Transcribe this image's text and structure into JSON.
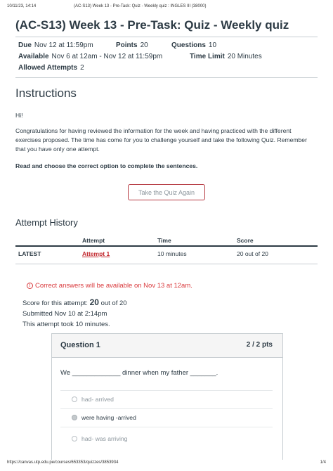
{
  "print_header": {
    "datetime": "10/11/23, 14:14",
    "doc_title": "(AC-S13) Week 13 - Pre-Task: Quiz - Weekly quiz : INGLES III (38000)"
  },
  "quiz": {
    "title": "(AC-S13) Week 13 - Pre-Task: Quiz - Weekly quiz",
    "due_label": "Due",
    "due_value": "Nov 12 at 11:59pm",
    "points_label": "Points",
    "points_value": "20",
    "questions_label": "Questions",
    "questions_value": "10",
    "available_label": "Available",
    "available_value": "Nov 6 at 12am - Nov 12 at 11:59pm",
    "time_limit_label": "Time Limit",
    "time_limit_value": "20 Minutes",
    "allowed_attempts_label": "Allowed Attempts",
    "allowed_attempts_value": "2"
  },
  "instructions": {
    "heading": "Instructions",
    "greeting": "Hi!",
    "body": "Congratulations for having reviewed the information for the week and having practiced with the different exercises proposed. The time has come for you to challenge yourself and take the following Quiz. Remember that you have only one attempt.",
    "directive": "Read and choose the correct option to complete the sentences.",
    "button_label": "Take the Quiz Again"
  },
  "attempt_history": {
    "heading": "Attempt History",
    "columns": [
      "Attempt",
      "Time",
      "Score"
    ],
    "rows": [
      {
        "tag": "LATEST",
        "attempt": "Attempt 1",
        "time": "10 minutes",
        "score": "20 out of 20"
      }
    ]
  },
  "result": {
    "notice": "Correct answers will be available on Nov 13 at 12am.",
    "score_prefix": "Score for this attempt:",
    "score_value": "20",
    "score_suffix": "out of 20",
    "submitted": "Submitted Nov 10 at 2:14pm",
    "duration": "This attempt took 10 minutes."
  },
  "question": {
    "title": "Question 1",
    "points": "2 / 2 pts",
    "text": "We _____________ dinner when my father _______.",
    "answers": [
      {
        "label": "had- arrived",
        "selected": false
      },
      {
        "label": "were having -arrived",
        "selected": true
      },
      {
        "label": "had- was arriving",
        "selected": false
      }
    ]
  },
  "print_footer": {
    "url": "https://canvas.utp.edu.pe/courses/653353/quizzes/3853934",
    "page": "1/4"
  },
  "colors": {
    "accent_red": "#c2272d",
    "text": "#2d3b45",
    "muted": "#8b959c",
    "border": "#c7cdd1"
  }
}
